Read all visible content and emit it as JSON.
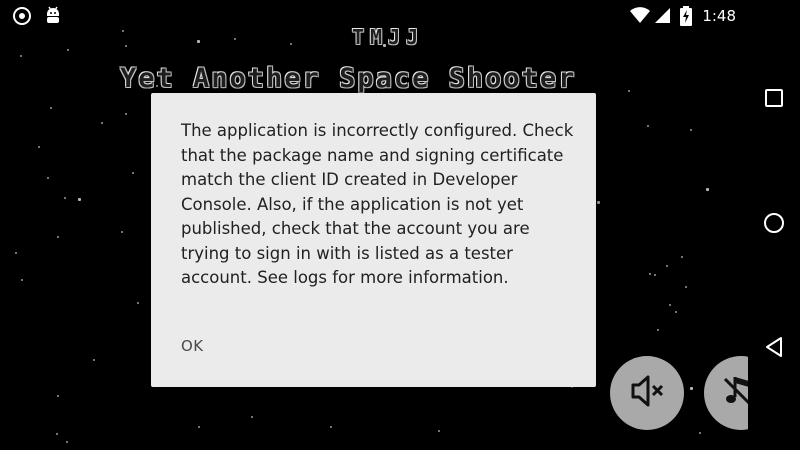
{
  "status_bar": {
    "time": "1:48",
    "left_icons": [
      "circle-target-icon",
      "android-debug-icon"
    ],
    "right_icons": [
      "wifi-icon",
      "cellular-signal-icon",
      "battery-charging-icon"
    ]
  },
  "game": {
    "title_top": "TMJJ",
    "title_main": "Yet Another Space Shooter",
    "buttons": {
      "mute_icon": "speaker-muted-icon",
      "music_icon": "music-note-off-icon"
    }
  },
  "dialog": {
    "message": "The application is incorrectly configured. Check that the package name and signing certificate match the client ID created in Developer Console. Also, if the application is not yet published, check that the account you are trying to sign in with is listed as a tester account. See logs for more information.",
    "ok_label": "OK"
  },
  "nav_bar": {
    "icons": [
      "recents-square-icon",
      "home-circle-icon",
      "back-triangle-icon"
    ]
  },
  "colors": {
    "background": "#000000",
    "dialog_background": "#ebebeb",
    "dialog_text": "#212121",
    "button_grey": "#a9a9a9"
  }
}
